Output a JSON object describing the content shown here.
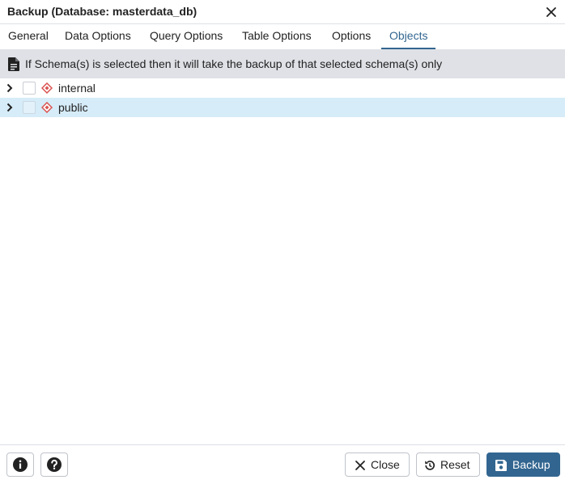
{
  "dialog": {
    "title": "Backup (Database: masterdata_db)",
    "close_icon": "close-icon"
  },
  "tabs": [
    {
      "label": "General",
      "active": false
    },
    {
      "label": "Data Options",
      "active": false
    },
    {
      "label": "Query Options",
      "active": false
    },
    {
      "label": "Table Options",
      "active": false
    },
    {
      "label": "Options",
      "active": false
    },
    {
      "label": "Objects",
      "active": true
    }
  ],
  "info": {
    "icon": "document-icon",
    "text": "If Schema(s) is selected then it will take the backup of that selected schema(s) only"
  },
  "tree": {
    "items": [
      {
        "label": "internal",
        "checked": false,
        "selected": false,
        "icon": "schema-icon"
      },
      {
        "label": "public",
        "checked": false,
        "selected": true,
        "icon": "schema-icon"
      }
    ]
  },
  "footer": {
    "info_icon": "info-icon",
    "help_icon": "help-icon",
    "close_label": "Close",
    "reset_label": "Reset",
    "backup_label": "Backup"
  },
  "colors": {
    "accent": "#326690",
    "selected_row": "#d6ecf8",
    "infobar_bg": "#dfe1e6",
    "schema_icon": "#d9534f"
  }
}
